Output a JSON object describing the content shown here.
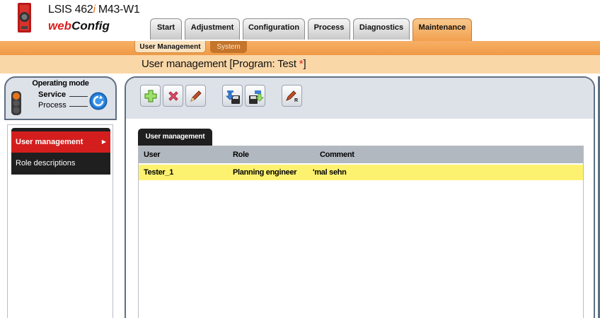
{
  "header": {
    "device_title_prefix": "LSIS 462",
    "device_title_i": "i",
    "device_title_suffix": " M43-W1",
    "brand_web": "web",
    "brand_config": "Config"
  },
  "main_tabs": [
    {
      "label": "Start"
    },
    {
      "label": "Adjustment"
    },
    {
      "label": "Configuration"
    },
    {
      "label": "Process"
    },
    {
      "label": "Diagnostics"
    },
    {
      "label": "Maintenance"
    }
  ],
  "sub_tabs": [
    {
      "label": "User Management"
    },
    {
      "label": "System"
    }
  ],
  "page": {
    "title": "User management   [Program: Test ",
    "title_star": "*",
    "title_end": "]"
  },
  "operating_mode": {
    "title": "Operating mode",
    "service": "Service",
    "process": "Process"
  },
  "nav": [
    {
      "label": "User management"
    },
    {
      "label": "Role descriptions"
    }
  ],
  "toolbar": {
    "icons": [
      "add-user-icon",
      "delete-user-icon",
      "edit-user-icon",
      "import-icon",
      "export-icon",
      "edit-role-icon"
    ]
  },
  "content": {
    "tab_label": "User management",
    "columns": [
      "User",
      "Role",
      "Comment"
    ],
    "rows": [
      {
        "user": "Tester_1",
        "role": "Planning engineer",
        "comment": "'mal sehn"
      }
    ]
  },
  "colors": {
    "accent_orange": "#f2a04e",
    "nav_active_red": "#d41e1e",
    "selected_row_yellow": "#fdf26f"
  }
}
